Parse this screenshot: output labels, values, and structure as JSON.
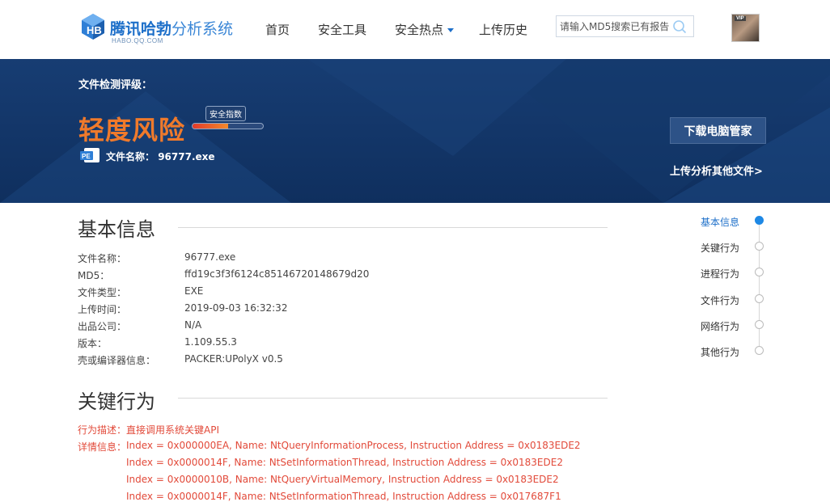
{
  "header": {
    "logo_title_main": "腾讯哈勃",
    "logo_title_sub": "分析系统",
    "logo_domain": "HABO.QQ.COM",
    "nav": [
      {
        "label": "首页"
      },
      {
        "label": "安全工具"
      },
      {
        "label": "安全热点"
      },
      {
        "label": "上传历史"
      }
    ],
    "search_placeholder": "请输入MD5搜索已有报告",
    "avatar_badge": "VIP"
  },
  "banner": {
    "level_label": "文件检测评级：",
    "risk_level": "轻度风险",
    "safety_index_label": "安全指数",
    "safety_index_value": 0.5,
    "file_name_label": "文件名称：",
    "file_name": "96777.exe",
    "download_button": "下载电脑管家",
    "upload_link": "上传分析其他文件>"
  },
  "basic_info": {
    "title": "基本信息",
    "rows": [
      {
        "key": "文件名称：",
        "value": "96777.exe"
      },
      {
        "key": "MD5：",
        "value": "ffd19c3f3f6124c85146720148679d20"
      },
      {
        "key": "文件类型：",
        "value": "EXE"
      },
      {
        "key": "上传时间：",
        "value": "2019-09-03 16:32:32"
      },
      {
        "key": "出品公司：",
        "value": "N/A"
      },
      {
        "key": "版本：",
        "value": "1.109.55.3"
      },
      {
        "key": "壳或编译器信息：",
        "value": "PACKER:UPolyX v0.5"
      }
    ]
  },
  "key_behavior": {
    "title": "关键行为",
    "desc_label": "行为描述：",
    "desc_value": "直接调用系统关键API",
    "detail_label": "详情信息：",
    "details": [
      "Index = 0x000000EA, Name: NtQueryInformationProcess, Instruction Address = 0x0183EDE2",
      "Index = 0x0000014F, Name: NtSetInformationThread, Instruction Address = 0x0183EDE2",
      "Index = 0x0000010B, Name: NtQueryVirtualMemory, Instruction Address = 0x0183EDE2",
      "Index = 0x0000014F, Name: NtSetInformationThread, Instruction Address = 0x017687F1"
    ]
  },
  "side_nav": [
    {
      "label": "基本信息",
      "active": true
    },
    {
      "label": "关键行为"
    },
    {
      "label": "进程行为"
    },
    {
      "label": "文件行为"
    },
    {
      "label": "网络行为"
    },
    {
      "label": "其他行为"
    }
  ]
}
